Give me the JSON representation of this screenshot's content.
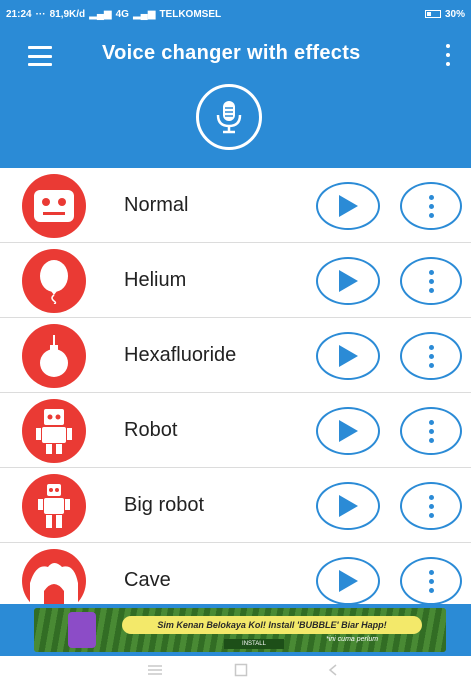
{
  "status_bar": {
    "time": "21:24",
    "dots": "···",
    "speed": "81,9K/d",
    "network": "4G",
    "carrier": "TELKOMSEL",
    "battery": "30%"
  },
  "app_bar": {
    "title": "Voice changer with effects"
  },
  "effects": [
    {
      "label": "Normal",
      "icon": "normal-face-icon"
    },
    {
      "label": "Helium",
      "icon": "helium-balloon-icon"
    },
    {
      "label": "Hexafluoride",
      "icon": "hexafluoride-bomb-icon"
    },
    {
      "label": "Robot",
      "icon": "robot-icon"
    },
    {
      "label": "Big robot",
      "icon": "big-robot-icon"
    },
    {
      "label": "Cave",
      "icon": "cave-icon"
    }
  ],
  "ad": {
    "text": "Sim Kenan Belokaya Kol! Install 'BUBBLE' Biar Happ!",
    "sub": "*ini cuma perlum",
    "install": "INSTALL"
  },
  "colors": {
    "primary": "#2b8bd6",
    "effect_icon_bg": "#ea3a34"
  }
}
